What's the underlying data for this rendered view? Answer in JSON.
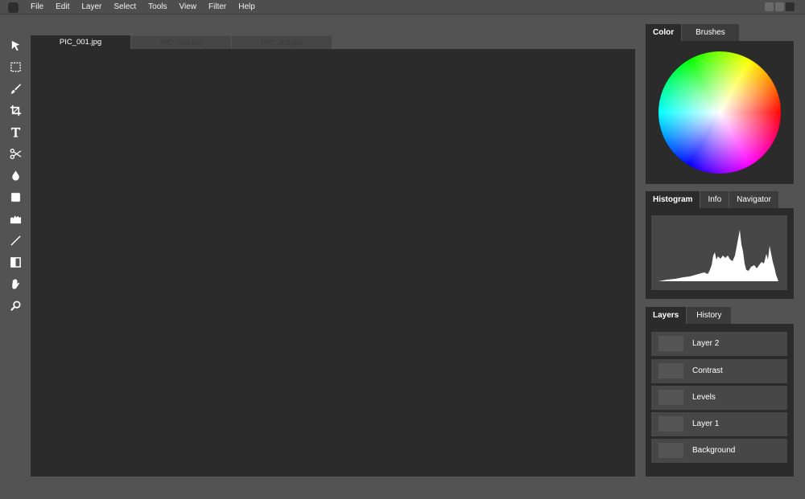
{
  "menu": {
    "items": [
      "File",
      "Edit",
      "Layer",
      "Select",
      "Tools",
      "View",
      "Filter",
      "Help"
    ]
  },
  "window_controls": [
    "minimize",
    "maximize",
    "close"
  ],
  "tools": [
    {
      "name": "move-tool",
      "icon": "arrow-cursor-icon"
    },
    {
      "name": "marquee-tool",
      "icon": "dashed-rectangle-icon"
    },
    {
      "name": "brush-tool",
      "icon": "brush-icon"
    },
    {
      "name": "crop-tool",
      "icon": "crop-icon"
    },
    {
      "name": "text-tool",
      "icon": "text-t-icon"
    },
    {
      "name": "cut-tool",
      "icon": "scissors-icon"
    },
    {
      "name": "blur-tool",
      "icon": "drop-icon"
    },
    {
      "name": "stamp-tool",
      "icon": "stamp-icon"
    },
    {
      "name": "histogram-tool",
      "icon": "levels-icon"
    },
    {
      "name": "line-tool",
      "icon": "line-icon"
    },
    {
      "name": "gradient-tool",
      "icon": "gradient-icon"
    },
    {
      "name": "hand-tool",
      "icon": "hand-icon"
    },
    {
      "name": "zoom-tool",
      "icon": "magnifier-icon"
    }
  ],
  "document_tabs": [
    {
      "label": "PIC_001.jpg",
      "active": true
    },
    {
      "label": "PIC_002.jpg",
      "active": false
    },
    {
      "label": "PIC_003.jpg",
      "active": false
    }
  ],
  "color_panel": {
    "tabs": [
      {
        "label": "Color",
        "active": true
      },
      {
        "label": "Brushes",
        "active": false
      }
    ]
  },
  "histogram_panel": {
    "tabs": [
      {
        "label": "Histogram",
        "active": true
      },
      {
        "label": "Info",
        "active": false
      },
      {
        "label": "Navigator",
        "active": false
      }
    ]
  },
  "layers_panel": {
    "tabs": [
      {
        "label": "Layers",
        "active": true
      },
      {
        "label": "History",
        "active": false
      }
    ],
    "layers": [
      {
        "name": "Layer 2"
      },
      {
        "name": "Contrast"
      },
      {
        "name": "Levels"
      },
      {
        "name": "Layer 1"
      },
      {
        "name": "Background"
      }
    ]
  },
  "colors": {
    "background": "#535353",
    "canvas": "#2b2b2b",
    "panel": "#2b2b2b",
    "row": "#474747",
    "win_close": "#2e2e2e",
    "win_other": "#6a6a6a"
  }
}
